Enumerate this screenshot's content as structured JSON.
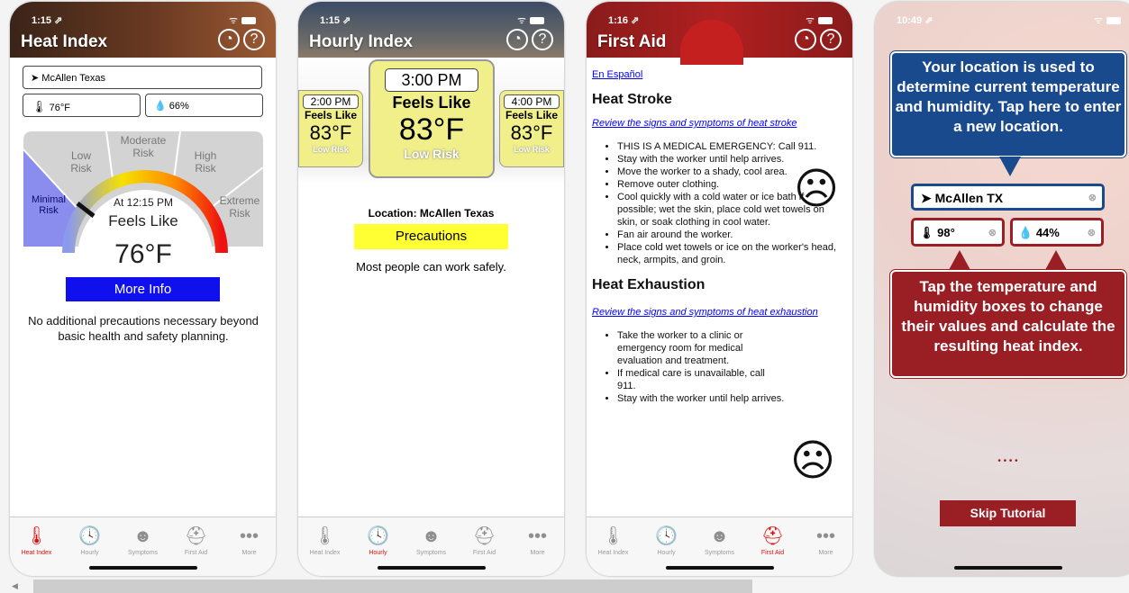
{
  "screen1": {
    "time": "1:15 ⇗",
    "title": "Heat Index",
    "location": "McAllen Texas",
    "temp": "76°F",
    "humidity": "66%",
    "risks": {
      "minimal": "Minimal\nRisk",
      "low": "Low\nRisk",
      "moderate": "Moderate\nRisk",
      "high": "High\nRisk",
      "extreme": "Extreme\nRisk"
    },
    "at_time": "At 12:15 PM",
    "feels_like": "Feels Like",
    "value": "76°F",
    "more_info": "More Info",
    "message": "No additional precautions necessary beyond basic health and safety planning."
  },
  "screen2": {
    "time": "1:15 ⇗",
    "title": "Hourly Index",
    "left": {
      "time": "2:00 PM",
      "feels": "Feels Like",
      "value": "83°F",
      "risk": "Low Risk"
    },
    "center": {
      "time": "3:00 PM",
      "feels": "Feels Like",
      "value": "83°F",
      "risk": "Low Risk"
    },
    "right": {
      "time": "4:00 PM",
      "feels": "Feels Like",
      "value": "83°F",
      "risk": "Low Risk"
    },
    "location": "Location: McAllen Texas",
    "precautions": "Precautions",
    "message": "Most people can work safely."
  },
  "screen3": {
    "time": "1:16 ⇗",
    "title": "First Aid",
    "espanol": "En Español",
    "stroke_heading": "Heat Stroke",
    "stroke_link": "Review the signs and symptoms of heat stroke",
    "stroke_items": [
      "THIS IS A MEDICAL EMERGENCY: Call 911.",
      "Stay with the worker until help arrives.",
      "Move the worker to a shady, cool area.",
      "Remove outer clothing.",
      "Cool quickly with a cold water or ice bath if possible; wet the skin, place cold wet towels on skin, or soak clothing in cool water.",
      "Fan air around the worker.",
      "Place cold wet towels or ice on the worker's head, neck, armpits, and groin."
    ],
    "exh_heading": "Heat Exhaustion",
    "exh_link": "Review the signs and symptoms of heat exhaustion",
    "exh_items": [
      "Take the worker to a clinic or emergency room for medical evaluation and treatment.",
      "If medical care is unavailable, call 911.",
      "Stay with the worker until help arrives."
    ]
  },
  "screen4": {
    "time": "10:49 ⇗",
    "callout_top": "Your location is used to determine current temperature and humidity. Tap here to enter a new location.",
    "location": "McAllen TX",
    "temp": "98°",
    "humidity": "44%",
    "callout_bottom": "Tap the temperature and humidity boxes to change their values and calculate the resulting heat index.",
    "dots": "• • • •",
    "skip": "Skip Tutorial"
  },
  "tabs": {
    "heat": "Heat Index",
    "hourly": "Hourly",
    "symptoms": "Symptoms",
    "firstaid": "First Aid",
    "more": "More"
  },
  "colors": {
    "accent_red": "#d11",
    "tutorial_blue": "#1a4a8e",
    "tutorial_red": "#9a1f24",
    "precaution_yellow": "#ffff33",
    "more_info_blue": "#1010ee"
  }
}
